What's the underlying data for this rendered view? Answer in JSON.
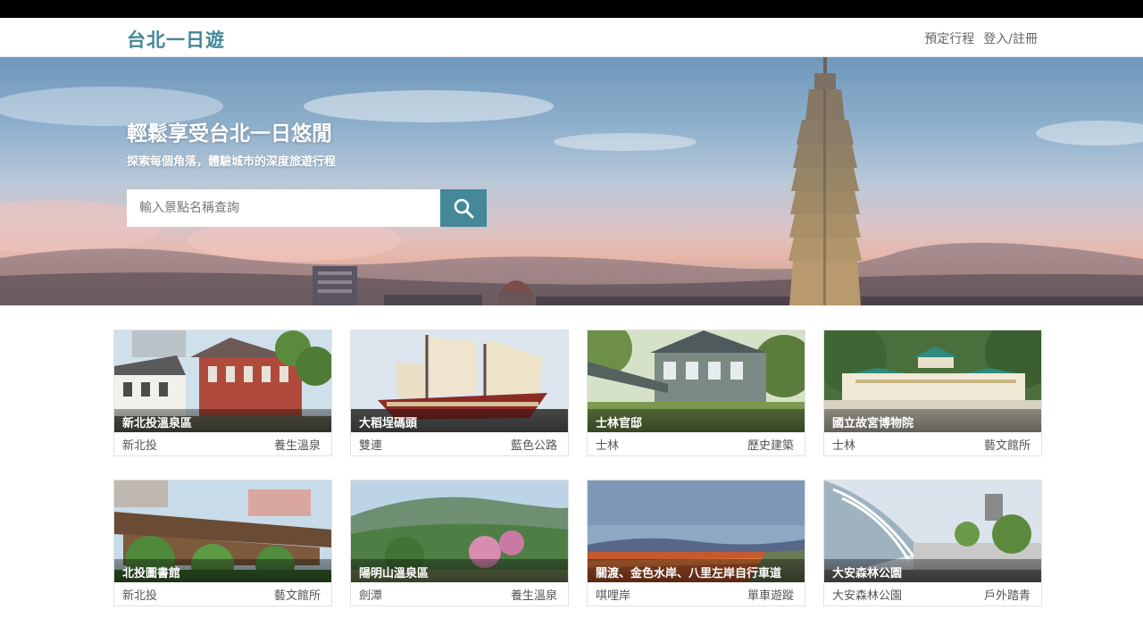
{
  "app": {
    "logo": "台北一日遊",
    "nav": [
      "預定行程",
      "登入/註冊"
    ]
  },
  "hero": {
    "title": "輕鬆享受台北一日悠閒",
    "subtitle": "探索每個角落，體驗城市的深度旅遊行程",
    "search_placeholder": "輸入景點名稱查詢"
  },
  "icons": {
    "search": "search-icon"
  },
  "colors": {
    "accent": "#448899"
  },
  "attractions": [
    {
      "name": "新北投溫泉區",
      "area": "新北投",
      "category": "養生溫泉"
    },
    {
      "name": "大稻埕碼頭",
      "area": "雙連",
      "category": "藍色公路"
    },
    {
      "name": "士林官邸",
      "area": "士林",
      "category": "歷史建築"
    },
    {
      "name": "國立故宮博物院",
      "area": "士林",
      "category": "藝文館所"
    },
    {
      "name": "北投圖書館",
      "area": "新北投",
      "category": "藝文館所"
    },
    {
      "name": "陽明山溫泉區",
      "area": "劍潭",
      "category": "養生溫泉"
    },
    {
      "name": "關渡、金色水岸、八里左岸自行車道",
      "area": "唭哩岸",
      "category": "單車遊蹤"
    },
    {
      "name": "大安森林公園",
      "area": "大安森林公園",
      "category": "戶外踏青"
    }
  ]
}
